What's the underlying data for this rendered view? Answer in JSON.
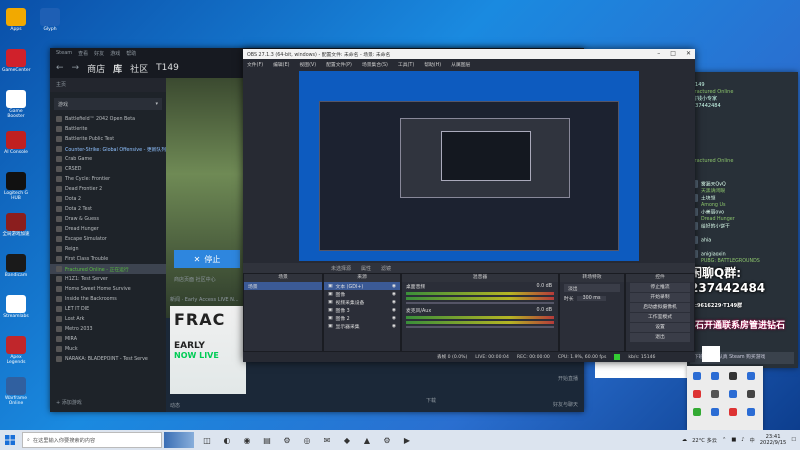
{
  "desktop": {
    "icons": [
      {
        "label": "Apps",
        "color": "#f2a900"
      },
      {
        "label": "GameCenter",
        "color": "#d0212b"
      },
      {
        "label": "Game Booster",
        "color": "#ffffff"
      },
      {
        "label": "AI Console",
        "color": "#c02020"
      },
      {
        "label": "Logitech G HUB",
        "color": "#111111"
      },
      {
        "label": "全局游戏加速",
        "color": "#8b1e1e"
      },
      {
        "label": "Bandicam",
        "color": "#1a1a1a"
      },
      {
        "label": "Streamlabs",
        "color": "#ffffff"
      },
      {
        "label": "Apex Legends",
        "color": "#c0262b"
      },
      {
        "label": "Warframe Online",
        "color": "#3060a0"
      }
    ],
    "top_icons": [
      {
        "label": "Glyph",
        "color": "#1e5fb4"
      }
    ]
  },
  "steam": {
    "titlebar_items": [
      "Steam",
      "查看",
      "好友",
      "游戏",
      "帮助"
    ],
    "nav": {
      "back": "←",
      "forward": "→",
      "store": "商店",
      "library": "库",
      "community": "社区",
      "user": "T149"
    },
    "home": "主页",
    "filter": "游戏",
    "games": [
      {
        "name": "Battlefield™ 2042 Open Beta",
        "state": ""
      },
      {
        "name": "Battlerite",
        "state": ""
      },
      {
        "name": "Battlerite Public Test",
        "state": ""
      },
      {
        "name": "Counter-Strike: Global Offensive - 更新队列",
        "state": "hl"
      },
      {
        "name": "Crab Game",
        "state": ""
      },
      {
        "name": "CRSED",
        "state": ""
      },
      {
        "name": "The Cycle: Frontier",
        "state": ""
      },
      {
        "name": "Dead Frontier 2",
        "state": ""
      },
      {
        "name": "Dota 2",
        "state": ""
      },
      {
        "name": "Dota 2 Test",
        "state": ""
      },
      {
        "name": "Draw & Guess",
        "state": ""
      },
      {
        "name": "Dread Hunger",
        "state": ""
      },
      {
        "name": "Escape Simulator",
        "state": ""
      },
      {
        "name": "Reign",
        "state": ""
      },
      {
        "name": "First Class Trouble",
        "state": ""
      },
      {
        "name": "Fractured Online - 正在运行",
        "state": "sel"
      },
      {
        "name": "H1Z1: Test Server",
        "state": ""
      },
      {
        "name": "Home Sweet Home Survive",
        "state": ""
      },
      {
        "name": "Inside the Backrooms",
        "state": ""
      },
      {
        "name": "LET IT DIE",
        "state": ""
      },
      {
        "name": "Lost Ark",
        "state": ""
      },
      {
        "name": "Metro 2033",
        "state": ""
      },
      {
        "name": "MIRA",
        "state": ""
      },
      {
        "name": "Muck",
        "state": ""
      },
      {
        "name": "NARAKA: BLADEPOINT - Test Serve",
        "state": ""
      }
    ],
    "add_game": "添加游戏",
    "stop_button": "停止",
    "stop_icon": "close-icon",
    "sub_tabs": "商店页面    社区中心",
    "news_label": "新闻 · Early Access LIVE N...",
    "banner": {
      "line1": "FRAC",
      "line2": "EARLY",
      "line3": "NOW LIVE"
    },
    "activity": "动态",
    "downloads": "下载",
    "start_stream": "开始直播",
    "friends": "好友与聊天"
  },
  "obs": {
    "title": "OBS 27.1.3 (64-bit, windows) - 配置文件: 未命名 - 场景: 未命名",
    "menu": [
      "文件(F)",
      "编辑(E)",
      "视图(V)",
      "配置文件(P)",
      "场景集合(S)",
      "工具(T)",
      "帮助(H)",
      "从属图层"
    ],
    "preview_caption": "未选择源",
    "ctrl_items": [
      "属性",
      "滤镜"
    ],
    "docks": {
      "scenes": {
        "title": "场景",
        "items": [
          "场景"
        ]
      },
      "sources": {
        "title": "来源",
        "items": [
          "文本 (GDI+)",
          "图像",
          "视频采集设备",
          "图像 3",
          "图像 2",
          "显示器采集"
        ]
      },
      "mixer": {
        "title": "混音器",
        "tracks": [
          {
            "name": "桌面音频",
            "level": "0.0 dB"
          },
          {
            "name": "麦克风/Aux",
            "level": "0.0 dB"
          }
        ]
      },
      "transitions": {
        "title": "转场特效",
        "mode": "淡出",
        "duration_label": "时长",
        "duration": "300 ms"
      },
      "controls": {
        "title": "控件",
        "buttons": [
          "停止推流",
          "开始录制",
          "启动虚拟摄像机",
          "工作室模式",
          "设置",
          "退出"
        ]
      }
    },
    "status": {
      "dropped": "丢帧 0 (0.0%)",
      "live": "LIVE: 00:00:04",
      "rec": "REC: 00:00:00",
      "cpu": "CPU: 1.9%, 60.00 fps",
      "kbps": "kb/s: 15146"
    }
  },
  "chat": {
    "name_line1": "T149",
    "name_line2": "Fractured Online",
    "name_line3": "省钱小专家",
    "id": "237442484",
    "fractured": "Fractured Online",
    "friends": [
      {
        "name": "雾漏天QvQ",
        "status": "天黑请闭眼"
      },
      {
        "name": "土块领",
        "status": "Among Us"
      },
      {
        "name": "小美丽ovo",
        "status": "Dread Hunger"
      },
      {
        "name": "给好的小饼干",
        "status": ""
      },
      {
        "name": "ahia",
        "status": ""
      },
      {
        "name": "anigiaoxin",
        "status": "PUBG: BATTLEGROUNDS"
      }
    ],
    "qq_group": "闲聊Q群:",
    "qq_number": "237442484",
    "qq_group2": "群:9616229·T149群",
    "gang": "钻石开通联系房管进钻石",
    "card": "下班了也在认真 Steam 购买游戏",
    "msg_icon": "chat-icon"
  },
  "taskbar": {
    "search_placeholder": "在这里输入你要搜索的内容",
    "temperature": "22°C 多云",
    "ime": "中",
    "time": "23:41",
    "date": "2022/9/15",
    "apps": [
      "task-view-icon",
      "edge-icon",
      "chrome-icon",
      "explorer-icon",
      "steam-icon",
      "obs-icon",
      "wechat-icon",
      "qq-icon",
      "logitech-icon",
      "settings-icon",
      "media-icon"
    ]
  },
  "colors": {
    "steam_bg": "#1b2838",
    "obs_bg": "#272a33",
    "accent": "#2e86de",
    "running": "#59bf40"
  }
}
